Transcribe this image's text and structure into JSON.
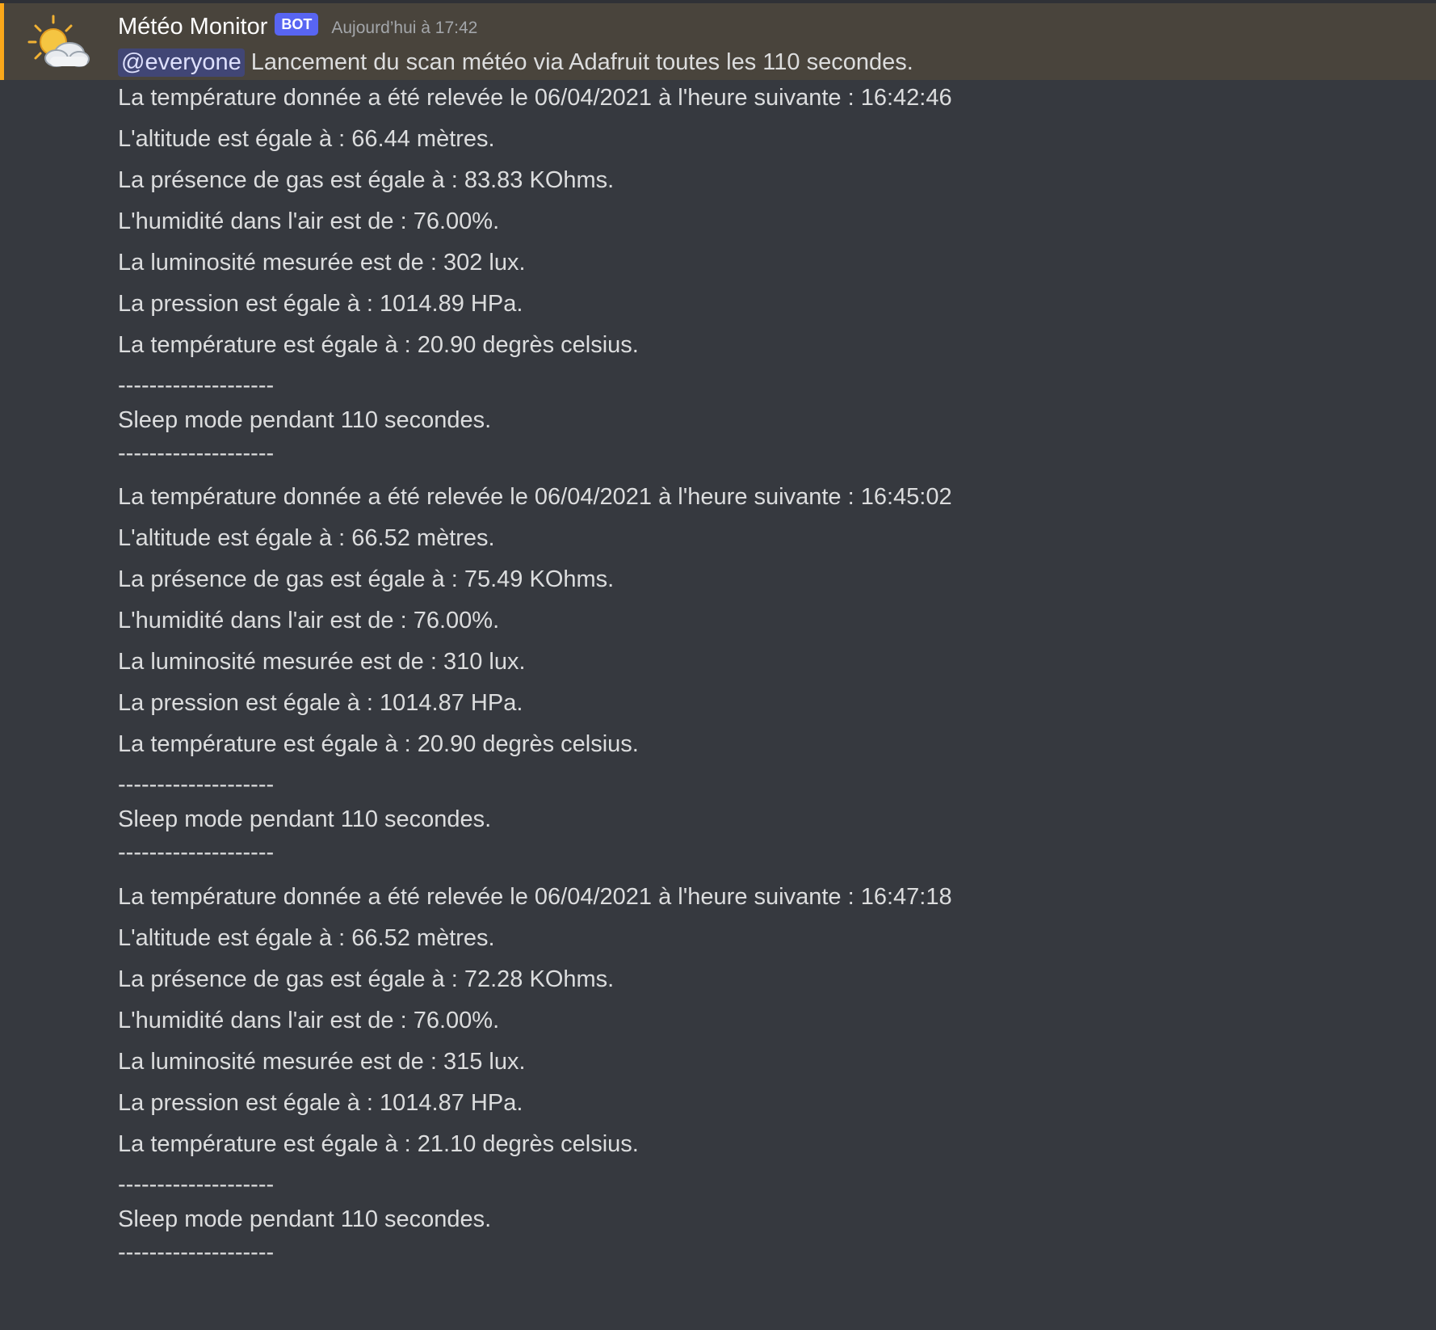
{
  "message": {
    "username": "Météo Monitor",
    "bot_tag": "BOT",
    "timestamp": "Aujourd’hui à 17:42",
    "avatar_icon": "sun-behind-cloud-icon",
    "mention": "@everyone",
    "intro": "Lancement du scan météo via Adafruit toutes les 110 secondes.",
    "mention_color": "#faa81a"
  },
  "lines": [
    "La température donnée a été relevée le 06/04/2021 à l'heure suivante : 16:42:46",
    "L'altitude est égale à : 66.44 mètres.",
    "La présence de gas est égale à : 83.83 KOhms.",
    "L'humidité dans l'air est de : 76.00%.",
    "La luminosité mesurée est de : 302 lux.",
    "La pression est égale à : 1014.89 HPa.",
    "La température est égale à : 20.90 degrès celsius.",
    "--------------------",
    "Sleep mode pendant 110 secondes.",
    "--------------------",
    "La température donnée a été relevée le 06/04/2021 à l'heure suivante : 16:45:02",
    "L'altitude est égale à : 66.52 mètres.",
    "La présence de gas est égale à : 75.49 KOhms.",
    "L'humidité dans l'air est de : 76.00%.",
    "La luminosité mesurée est de : 310 lux.",
    "La pression est égale à : 1014.87 HPa.",
    "La température est égale à : 20.90 degrès celsius.",
    "--------------------",
    "Sleep mode pendant 110 secondes.",
    "--------------------",
    "La température donnée a été relevée le 06/04/2021 à l'heure suivante : 16:47:18",
    "L'altitude est égale à : 66.52 mètres.",
    "La présence de gas est égale à : 72.28 KOhms.",
    "L'humidité dans l'air est de : 76.00%.",
    "La luminosité mesurée est de : 315 lux.",
    "La pression est égale à : 1014.87 HPa.",
    "La température est égale à : 21.10 degrès celsius.",
    "--------------------",
    "Sleep mode pendant 110 secondes.",
    "--------------------"
  ]
}
